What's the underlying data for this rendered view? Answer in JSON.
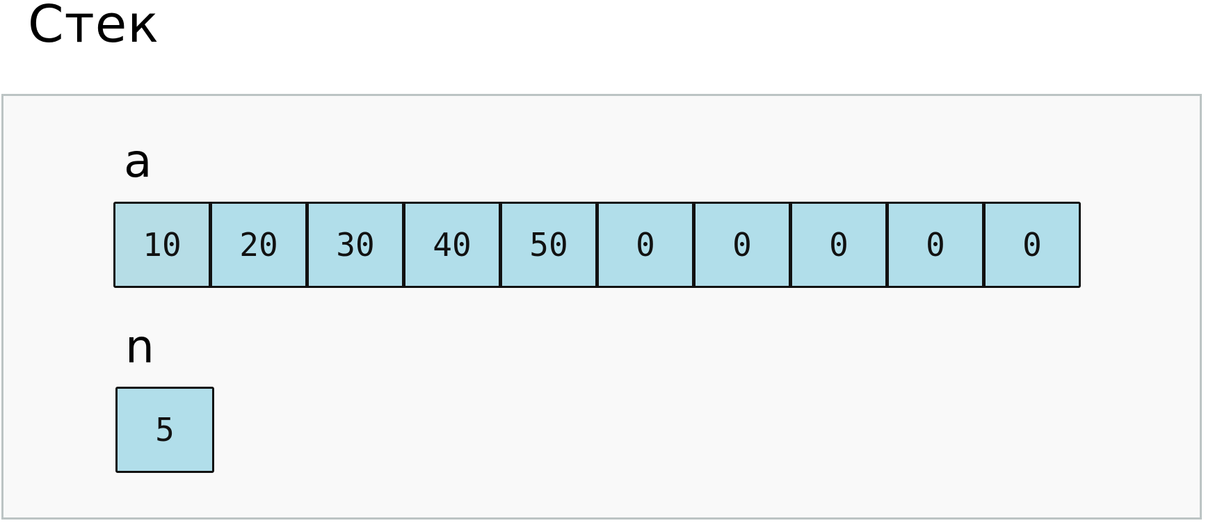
{
  "title": "Стек",
  "frame": {
    "variables": {
      "a": {
        "name": "a",
        "values": [
          "10",
          "20",
          "30",
          "40",
          "50",
          "0",
          "0",
          "0",
          "0",
          "0"
        ]
      },
      "n": {
        "name": "n",
        "value": "5"
      }
    }
  },
  "colors": {
    "cell_fill": "#b1deea",
    "frame_fill": "#f9f9f9",
    "frame_border": "#bcc4c4",
    "cell_border": "#111111"
  }
}
